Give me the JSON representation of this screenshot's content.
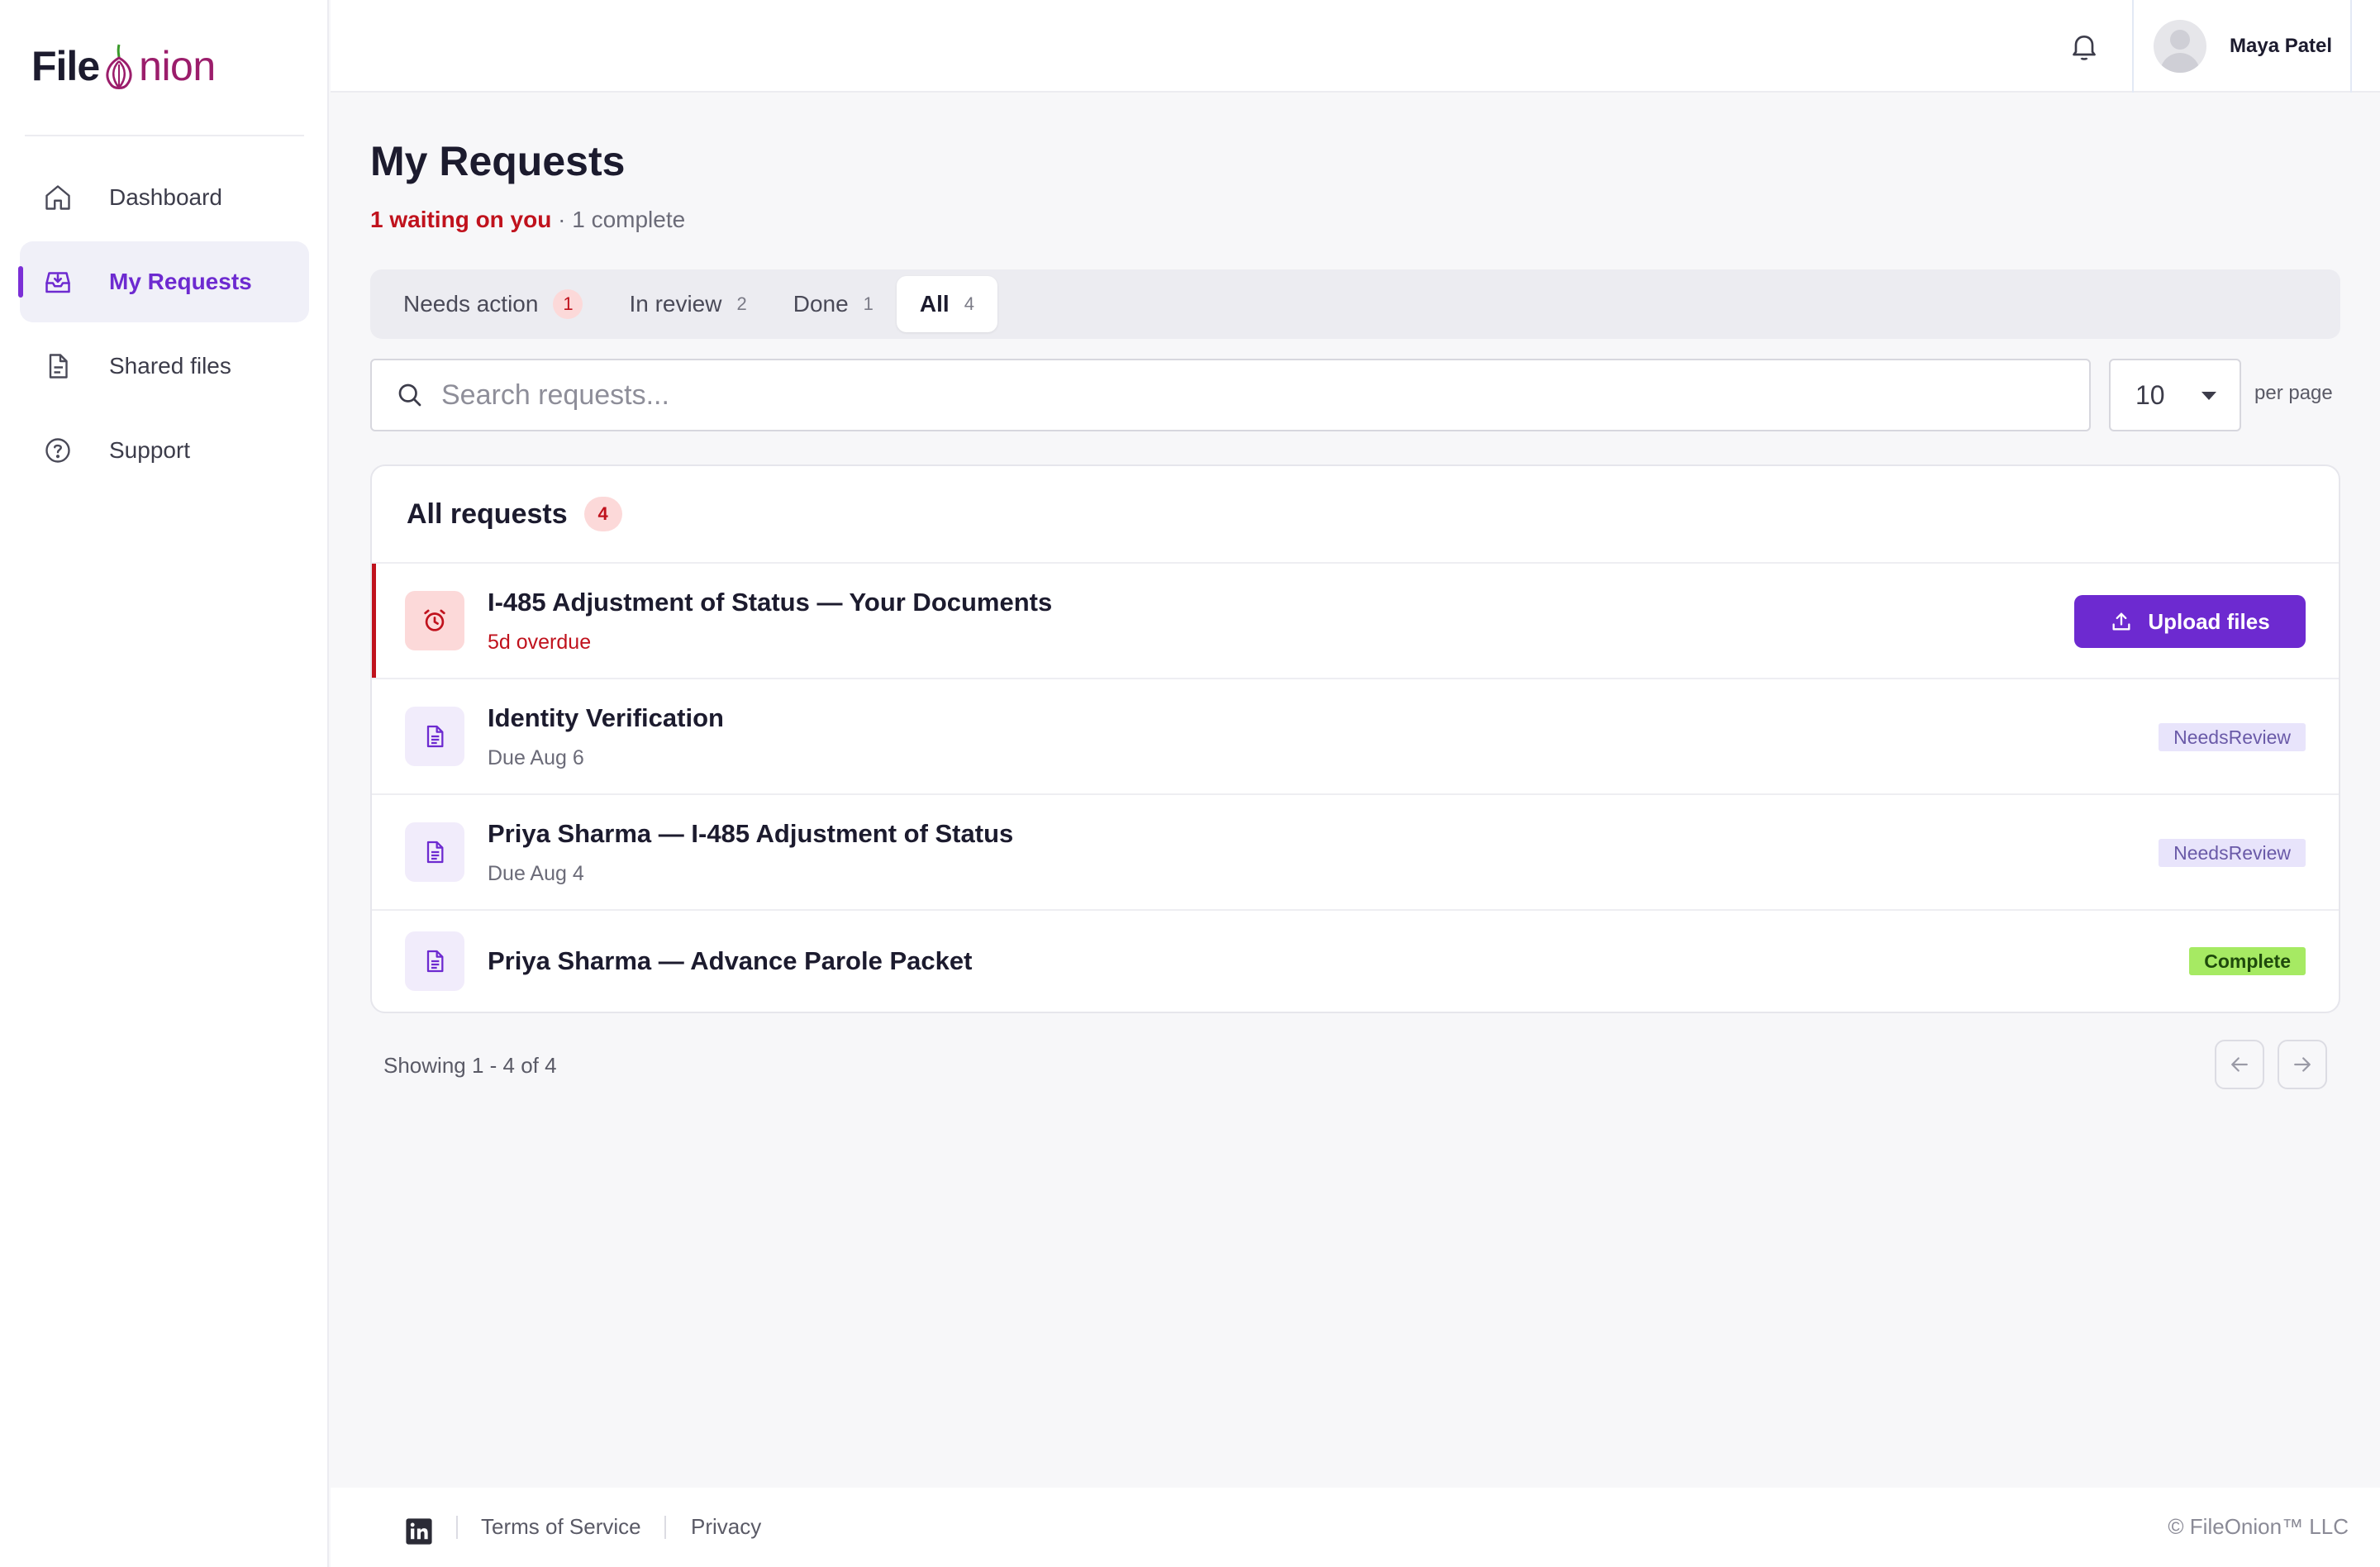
{
  "brand": {
    "name_part1": "File",
    "name_part2": "nion",
    "logo_glyph": "onion-icon",
    "accent": "#9b1d6b"
  },
  "sidebar": {
    "items": [
      {
        "label": "Dashboard",
        "icon": "home-icon",
        "active": false
      },
      {
        "label": "My Requests",
        "icon": "inbox-icon",
        "active": true
      },
      {
        "label": "Shared files",
        "icon": "file-icon",
        "active": false
      },
      {
        "label": "Support",
        "icon": "help-circle-icon",
        "active": false
      }
    ]
  },
  "header": {
    "notifications_icon": "bell-icon",
    "user_name": "Maya Patel"
  },
  "page": {
    "title": "My Requests",
    "summary_waiting": "1 waiting on you",
    "summary_rest": " · 1 complete"
  },
  "tabs": [
    {
      "label": "Needs action",
      "count": "1",
      "active": false
    },
    {
      "label": "In review",
      "count": "2",
      "active": false
    },
    {
      "label": "Done",
      "count": "1",
      "active": false
    },
    {
      "label": "All",
      "count": "4",
      "active": true
    }
  ],
  "search": {
    "placeholder": "Search requests...",
    "value": ""
  },
  "pagination": {
    "per_page_value": "10",
    "per_page_label": "per page",
    "showing": "Showing 1 - 4 of 4"
  },
  "requests": {
    "title": "All requests",
    "count": "4",
    "rows": [
      {
        "title": "I-485 Adjustment of Status — Your Documents",
        "sub": "5d overdue",
        "status": "overdue",
        "action": "Upload files"
      },
      {
        "title": "Identity Verification",
        "sub": "Due Aug 6",
        "status": "NeedsReview"
      },
      {
        "title": "Priya Sharma — I-485 Adjustment of Status",
        "sub": "Due Aug 4",
        "status": "NeedsReview"
      },
      {
        "title": "Priya Sharma — Advance Parole Packet",
        "sub": "",
        "status": "Complete"
      }
    ]
  },
  "footer": {
    "terms": "Terms of Service",
    "privacy": "Privacy",
    "copyright": "© FileOnion™ LLC",
    "social_icon": "linkedin-icon"
  },
  "colors": {
    "primary": "#6d2ad0",
    "danger": "#c0121d",
    "review_bg": "#e8e4fb",
    "complete_bg": "#a6ea63"
  }
}
